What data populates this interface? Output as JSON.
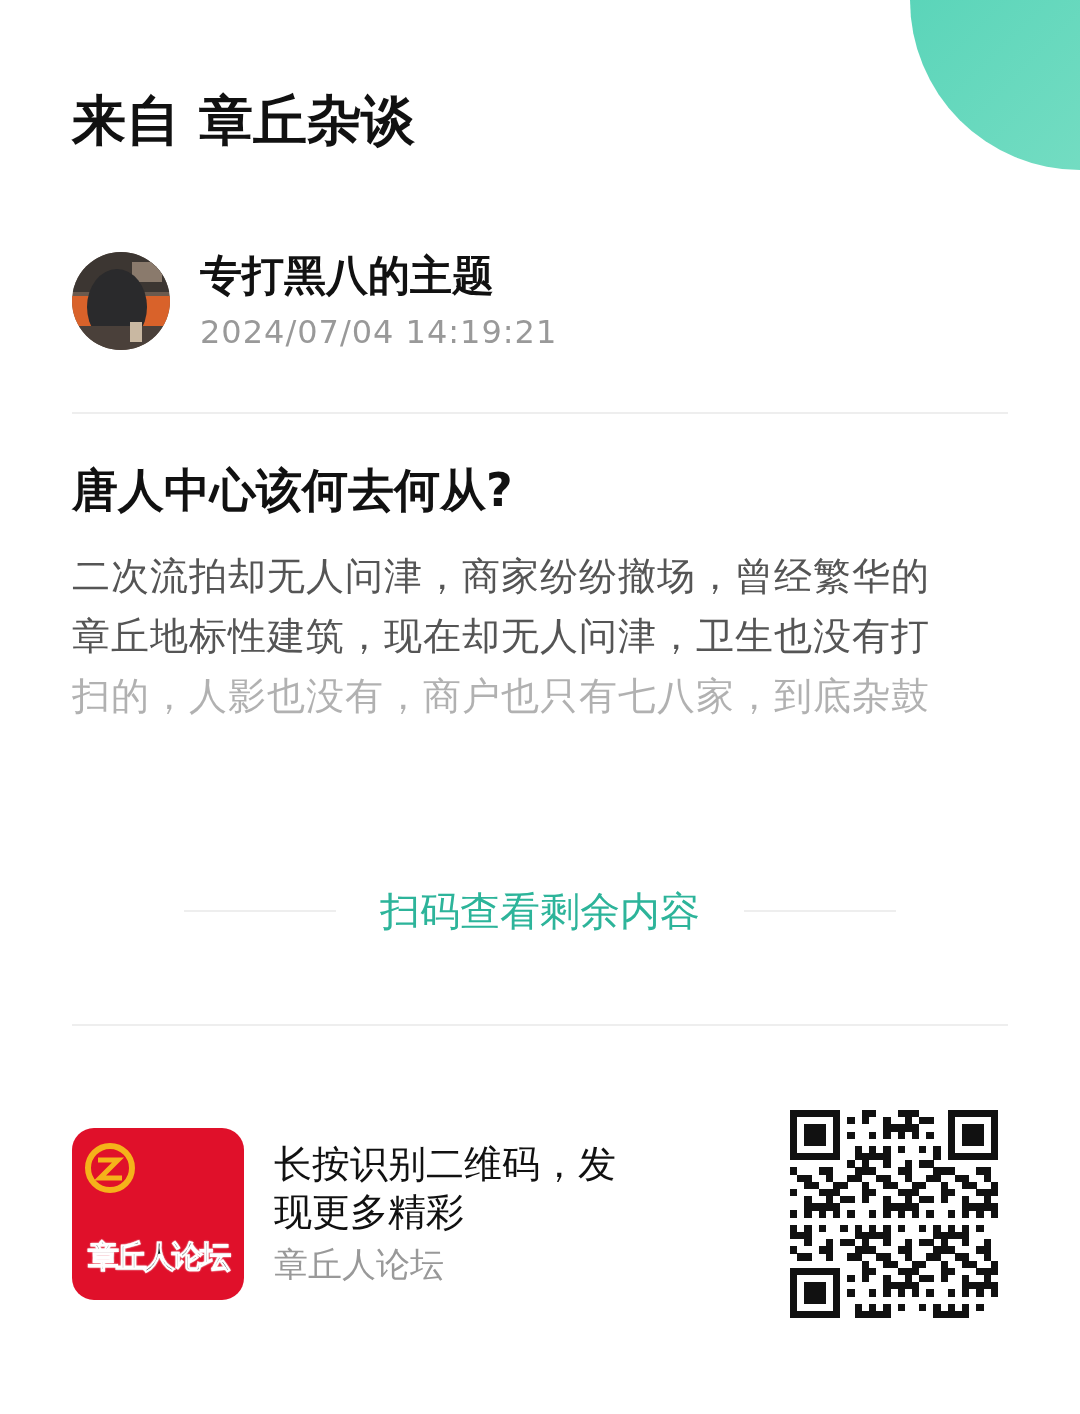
{
  "header": {
    "title": "来自 章丘杂谈"
  },
  "author": {
    "name": "专打黑八的主题",
    "time": "2024/07/04 14:19:21"
  },
  "post": {
    "title": "唐人中心该何去何从?",
    "body_lines": [
      "二次流拍却无人问津，商家纷纷撤场，曾经繁华的",
      "章丘地标性建筑，现在却无人问津，卫生也没有打",
      "扫的，人影也没有，商户也只有七八家，到底杂鼓"
    ]
  },
  "more_link": "扫码查看剩余内容",
  "footer": {
    "logo_text": "章丘人论坛",
    "prompt": "长按识别二维码，发现更多精彩",
    "source": "章丘人论坛"
  }
}
